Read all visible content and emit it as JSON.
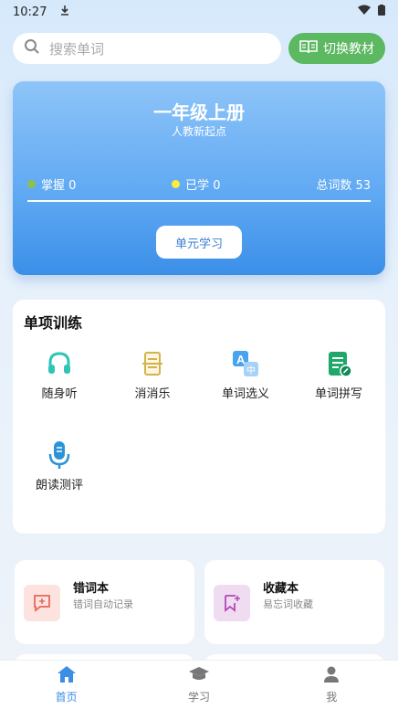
{
  "status": {
    "time": "10:27"
  },
  "search": {
    "placeholder": "搜索单词",
    "switch_label": "切换教材"
  },
  "book": {
    "title": "一年级上册",
    "subtitle": "人教新起点",
    "mastered_label": "掌握 0",
    "learned_label": "已学 0",
    "total_label": "总词数 53",
    "unit_button": "单元学习",
    "colors": {
      "mastered_dot": "#8bc34a",
      "learned_dot": "#ffeb3b"
    }
  },
  "practice": {
    "title": "单项训练",
    "items": [
      {
        "label": "随身听",
        "icon": "headphones-icon",
        "color": "#2ec4b6"
      },
      {
        "label": "消消乐",
        "icon": "cards-icon",
        "color": "#d4b24c"
      },
      {
        "label": "单词选义",
        "icon": "translate-icon",
        "color": "#4aa3ee"
      },
      {
        "label": "单词拼写",
        "icon": "spelling-icon",
        "color": "#20a86b"
      },
      {
        "label": "朗读测评",
        "icon": "microphone-icon",
        "color": "#2d93d8"
      }
    ]
  },
  "shortcuts": [
    {
      "title": "错词本",
      "subtitle": "错词自动记录",
      "icon": "wrong-words-icon",
      "bg": "#fde3df",
      "color": "#e8675a"
    },
    {
      "title": "收藏本",
      "subtitle": "易忘词收藏",
      "icon": "favorites-icon",
      "bg": "#f0dcf1",
      "color": "#b447b6"
    }
  ],
  "nav": [
    {
      "label": "首页",
      "icon": "home-icon",
      "active": true
    },
    {
      "label": "学习",
      "icon": "graduation-cap-icon",
      "active": false
    },
    {
      "label": "我",
      "icon": "person-icon",
      "active": false
    }
  ]
}
